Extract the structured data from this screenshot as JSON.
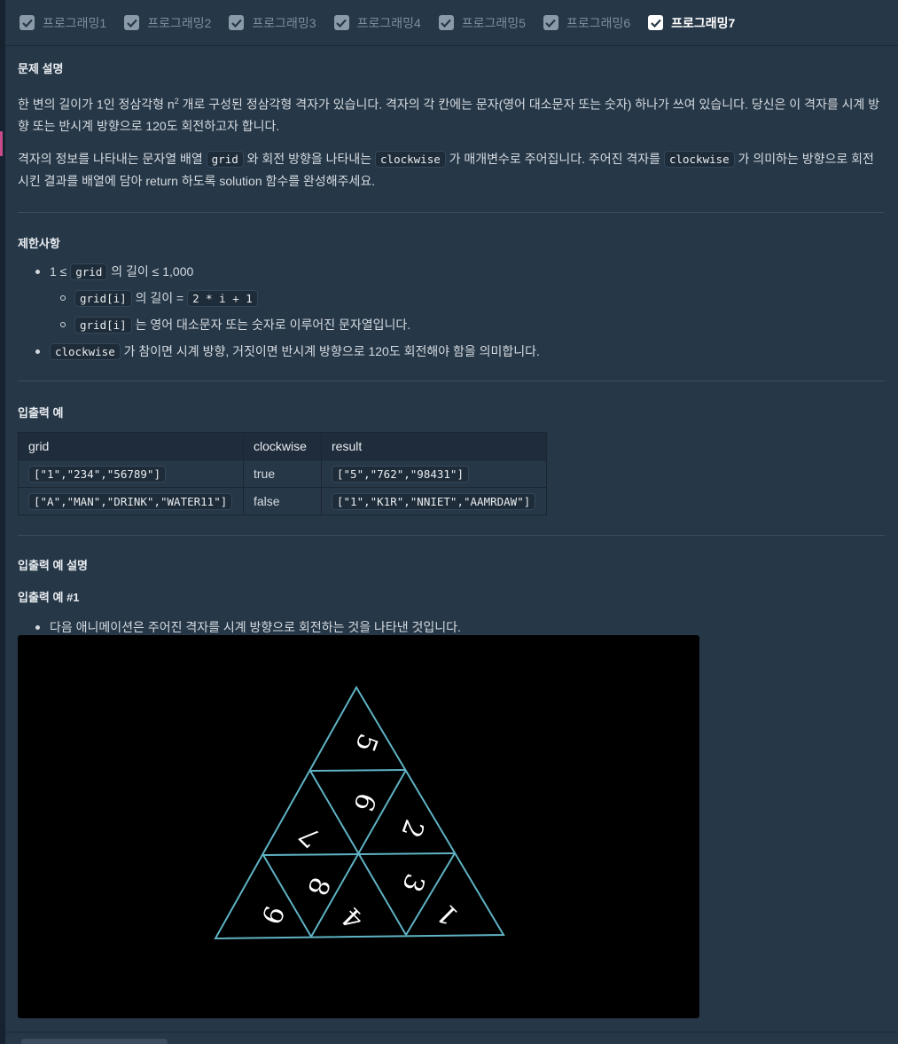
{
  "tabs": [
    {
      "label": "프로그래밍1"
    },
    {
      "label": "프로그래밍2"
    },
    {
      "label": "프로그래밍3"
    },
    {
      "label": "프로그래밍4"
    },
    {
      "label": "프로그래밍5"
    },
    {
      "label": "프로그래밍6"
    },
    {
      "label": "프로그래밍7"
    }
  ],
  "description": {
    "heading": "문제 설명",
    "p1_a": "한 변의 길이가 1인 정삼각형 n",
    "p1_sup": "2",
    "p1_b": " 개로 구성된 정삼각형 격자가 있습니다. 격자의 각 칸에는 문자(영어 대소문자 또는 숫자) 하나가 쓰여 있습니다. 당신은 이 격자를 시계 방향 또는 반시계 방향으로 120도 회전하고자 합니다.",
    "p2_a": "격자의 정보를 나타내는 문자열 배열 ",
    "p2_code1": "grid",
    "p2_b": " 와 회전 방향을 나타내는 ",
    "p2_code2": "clockwise",
    "p2_c": " 가 매개변수로 주어집니다. 주어진 격자를 ",
    "p2_code3": "clockwise",
    "p2_d": " 가 의미하는 방향으로 회전시킨 결과를 배열에 담아 return 하도록 solution 함수를 완성해주세요."
  },
  "constraints": {
    "heading": "제한사항",
    "c1_a": "1 ≤ ",
    "c1_code": "grid",
    "c1_b": " 의 길이 ≤ 1,000",
    "c2_code1": "grid[i]",
    "c2_a": " 의 길이 = ",
    "c2_code2": "2 * i + 1",
    "c3_code": "grid[i]",
    "c3_a": " 는 영어 대소문자 또는 숫자로 이루어진 문자열입니다.",
    "c4_code": "clockwise",
    "c4_a": " 가 참이면 시계 방향, 거짓이면 반시계 방향으로 120도 회전해야 함을 의미합니다."
  },
  "examples": {
    "heading": "입출력 예",
    "headers": [
      "grid",
      "clockwise",
      "result"
    ],
    "rows": [
      [
        "[\"1\",\"234\",\"56789\"]",
        "true",
        "[\"5\",\"762\",\"98431\"]"
      ],
      [
        "[\"A\",\"MAN\",\"DRINK\",\"WATER11\"]",
        "false",
        "[\"1\",\"K1R\",\"NNIET\",\"AAMRDAW\"]"
      ]
    ]
  },
  "explanation": {
    "heading": "입출력 예 설명",
    "sub": "입출력 예 #1",
    "bullet": "다음 애니메이션은 주어진 격자를 시계 방향으로 회전하는 것을 나타낸 것입니다."
  },
  "triangle": {
    "cells": [
      "5",
      "6",
      "7",
      "2",
      "8",
      "9",
      "4",
      "3",
      "1"
    ]
  }
}
